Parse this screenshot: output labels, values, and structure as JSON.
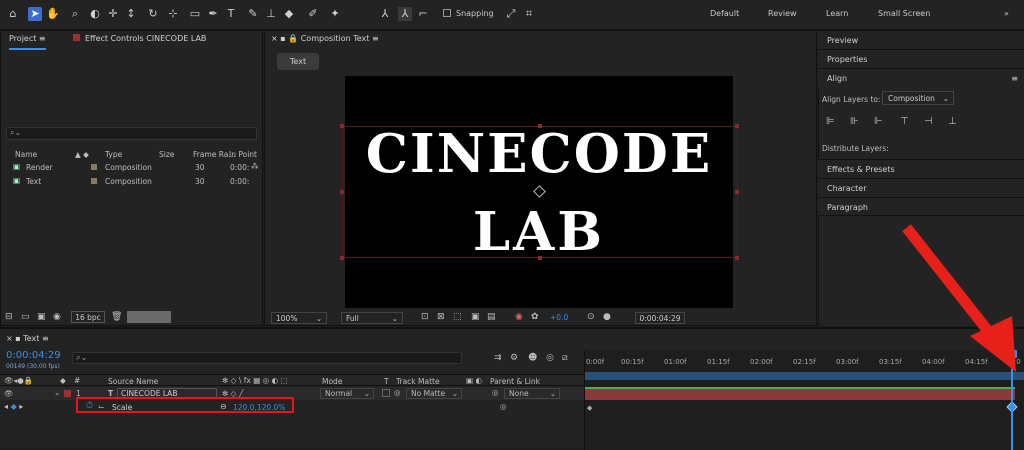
{
  "toolbar": {
    "snapping_label": "Snapping",
    "workspaces": [
      "Default",
      "Review",
      "Learn",
      "Small Screen"
    ]
  },
  "project_panel": {
    "tab_project": "Project",
    "tab_effect_controls": "Effect Controls CINECODE LAB",
    "search_placeholder": "",
    "columns": [
      "Name",
      "Type",
      "Size",
      "Frame Ra...",
      "In Point"
    ],
    "rows": [
      {
        "name": "Render",
        "type": "Composition",
        "frame_rate": "30",
        "in_point": "0:00:"
      },
      {
        "name": "Text",
        "type": "Composition",
        "frame_rate": "30",
        "in_point": "0:00:"
      }
    ],
    "bpc_label": "16 bpc"
  },
  "comp_panel": {
    "tab_label": "Composition Text",
    "comp_button": "Text",
    "title_line1": "CINECODE",
    "title_line2": "LAB",
    "zoom": "100%",
    "resolution": "Full",
    "exposure": "+0.0",
    "timecode": "0:00:04:29"
  },
  "right_panel": {
    "items": [
      "Preview",
      "Properties",
      "Align"
    ],
    "align_layers_to_label": "Align Layers to:",
    "align_target": "Composition",
    "distribute_label": "Distribute Layers:",
    "items_bottom": [
      "Effects & Presets",
      "Character",
      "Paragraph"
    ]
  },
  "timeline": {
    "tab_label": "Text",
    "current_time": "0:00:04:29",
    "frame_info": "00149 (30.00 fps)",
    "columns": {
      "source_name": "Source Name",
      "mode": "Mode",
      "t": "T",
      "track_matte": "Track Matte",
      "parent_link": "Parent & Link"
    },
    "layer": {
      "index": "1",
      "type_glyph": "T",
      "name": "CINECODE LAB",
      "mode": "Normal",
      "track_matte": "No Matte",
      "parent": "None"
    },
    "property": {
      "name": "Scale",
      "value": "120.0,120.0%"
    },
    "ruler_ticks": [
      "0:00f",
      "00:15f",
      "01:00f",
      "01:15f",
      "02:00f",
      "02:15f",
      "03:00f",
      "03:15f",
      "04:00f",
      "04:15f",
      "05:0"
    ]
  },
  "colors": {
    "accent_blue": "#3a8ee6",
    "highlight_red": "#e01818",
    "arrow_red": "#e8201a"
  }
}
